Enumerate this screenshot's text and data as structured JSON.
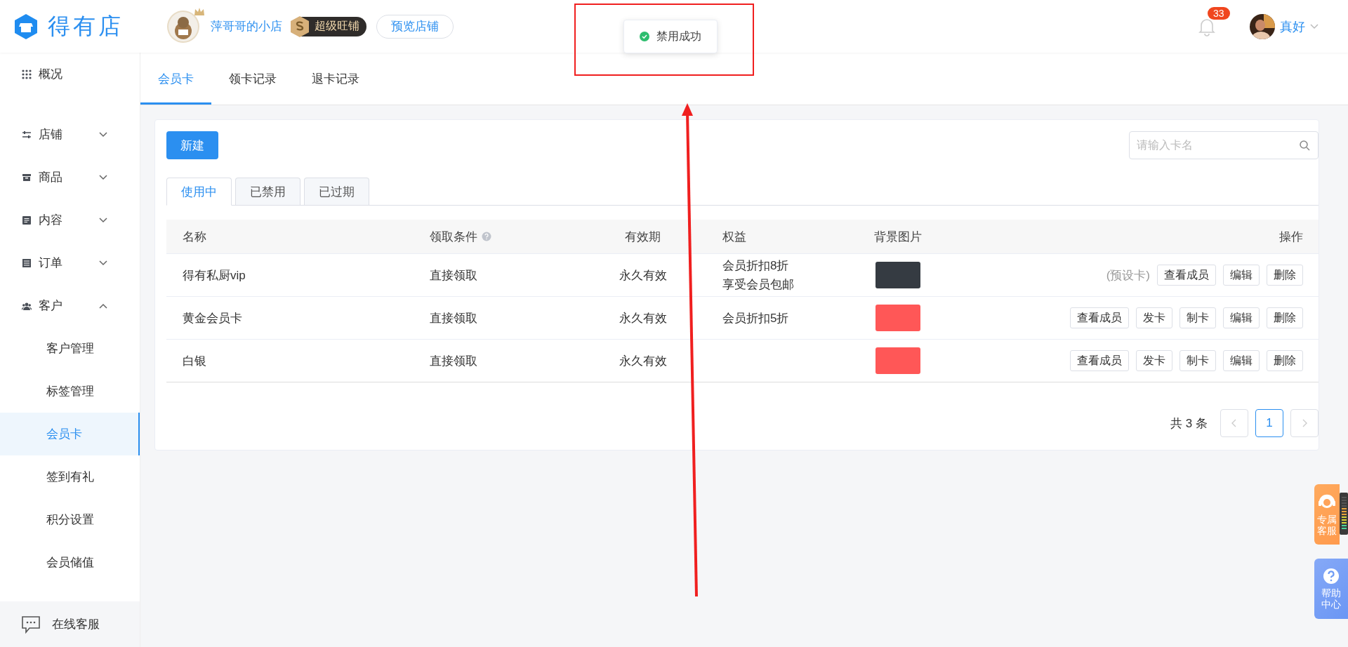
{
  "brand": {
    "name": "得有店"
  },
  "shop": {
    "name": "萍哥哥的小店",
    "badge": "超级旺铺",
    "preview_button": "预览店铺"
  },
  "toast": {
    "text": "禁用成功",
    "kind": "success"
  },
  "notifications": {
    "count": "33"
  },
  "user": {
    "name": "真好"
  },
  "sidebar": {
    "items": [
      {
        "label": "概况"
      },
      {
        "label": "店铺",
        "expanded": false
      },
      {
        "label": "商品",
        "expanded": false
      },
      {
        "label": "内容",
        "expanded": false
      },
      {
        "label": "订单",
        "expanded": false
      },
      {
        "label": "客户",
        "expanded": true,
        "children": [
          {
            "label": "客户管理",
            "selected": false
          },
          {
            "label": "标签管理",
            "selected": false
          },
          {
            "label": "会员卡",
            "selected": true
          },
          {
            "label": "签到有礼",
            "selected": false
          },
          {
            "label": "积分设置",
            "selected": false
          },
          {
            "label": "会员储值",
            "selected": false
          }
        ]
      }
    ],
    "footer_link": "在线客服"
  },
  "page_tabs": [
    {
      "label": "会员卡",
      "selected": true
    },
    {
      "label": "领卡记录",
      "selected": false
    },
    {
      "label": "退卡记录",
      "selected": false
    }
  ],
  "new_button": "新建",
  "search": {
    "placeholder": "请输入卡名"
  },
  "status_tabs": [
    {
      "label": "使用中",
      "selected": true
    },
    {
      "label": "已禁用",
      "selected": false
    },
    {
      "label": "已过期",
      "selected": false
    }
  ],
  "table": {
    "columns": [
      "名称",
      "领取条件",
      "有效期",
      "权益",
      "背景图片",
      "操作"
    ],
    "rows": [
      {
        "name": "得有私厨vip",
        "condition": "直接领取",
        "validity": "永久有效",
        "benefits": [
          "会员折扣8折",
          "享受会员包邮"
        ],
        "color": "#353b42",
        "note": "(预设卡)",
        "actions": [
          "查看成员",
          "编辑",
          "删除"
        ]
      },
      {
        "name": "黄金会员卡",
        "condition": "直接领取",
        "validity": "永久有效",
        "benefits": [
          "会员折扣5折"
        ],
        "color": "#ff5757",
        "actions": [
          "查看成员",
          "发卡",
          "制卡",
          "编辑",
          "删除"
        ]
      },
      {
        "name": "白银",
        "condition": "直接领取",
        "validity": "永久有效",
        "benefits": [],
        "color": "#ff5757",
        "actions": [
          "查看成员",
          "发卡",
          "制卡",
          "编辑",
          "删除"
        ]
      }
    ]
  },
  "pagination": {
    "total": "共 3 条",
    "pages": [
      {
        "label": "1",
        "selected": true
      }
    ]
  },
  "float_buttons": [
    {
      "label": "专属客服",
      "kind": "service"
    },
    {
      "label": "帮助中心",
      "kind": "help"
    }
  ]
}
